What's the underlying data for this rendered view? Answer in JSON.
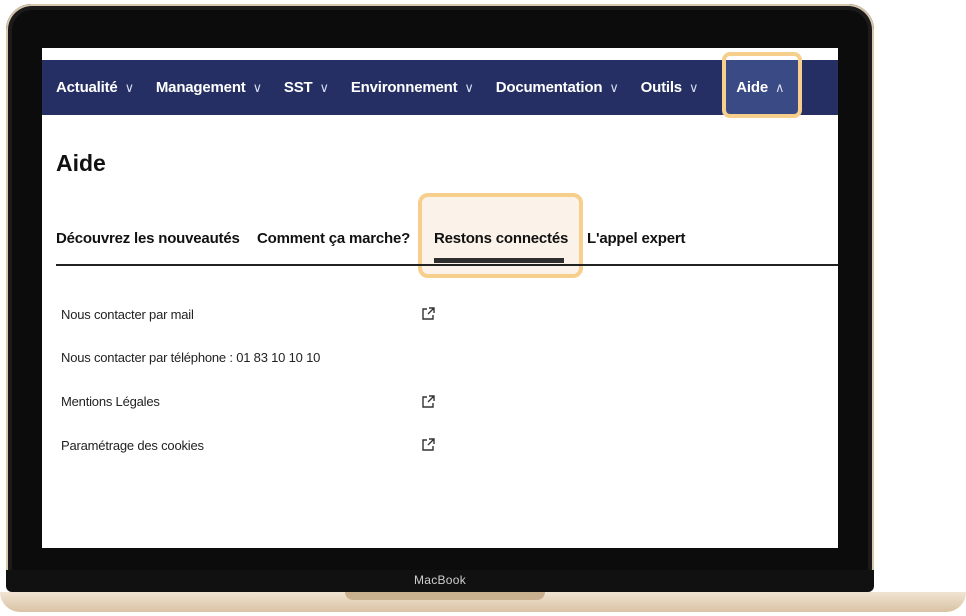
{
  "nav": {
    "items": [
      {
        "label": "Actualité",
        "chevron": "∨"
      },
      {
        "label": "Management",
        "chevron": "∨"
      },
      {
        "label": "SST",
        "chevron": "∨"
      },
      {
        "label": "Environnement",
        "chevron": "∨"
      },
      {
        "label": "Documentation",
        "chevron": "∨"
      },
      {
        "label": "Outils",
        "chevron": "∨"
      },
      {
        "label": "Aide",
        "chevron": "∧",
        "active": true
      }
    ]
  },
  "page": {
    "title": "Aide"
  },
  "tabs": [
    {
      "label": "Découvrez les nouveautés"
    },
    {
      "label": "Comment ça marche?"
    },
    {
      "label": "Restons connectés",
      "active": true
    },
    {
      "label": "L'appel expert"
    }
  ],
  "contacts": [
    {
      "label": "Nous contacter par mail",
      "icon": "external-link-icon"
    },
    {
      "label": "Nous contacter par téléphone : 01 83 10 10 10"
    },
    {
      "label": "Mentions Légales",
      "icon": "external-link-icon"
    },
    {
      "label": "Paramétrage des cookies",
      "icon": "external-link-icon"
    }
  ],
  "device": {
    "brand": "MacBook"
  },
  "colors": {
    "nav_bg": "#252f63",
    "highlight": "#f6cf8d",
    "active_tab_bg": "#3a4a85"
  }
}
